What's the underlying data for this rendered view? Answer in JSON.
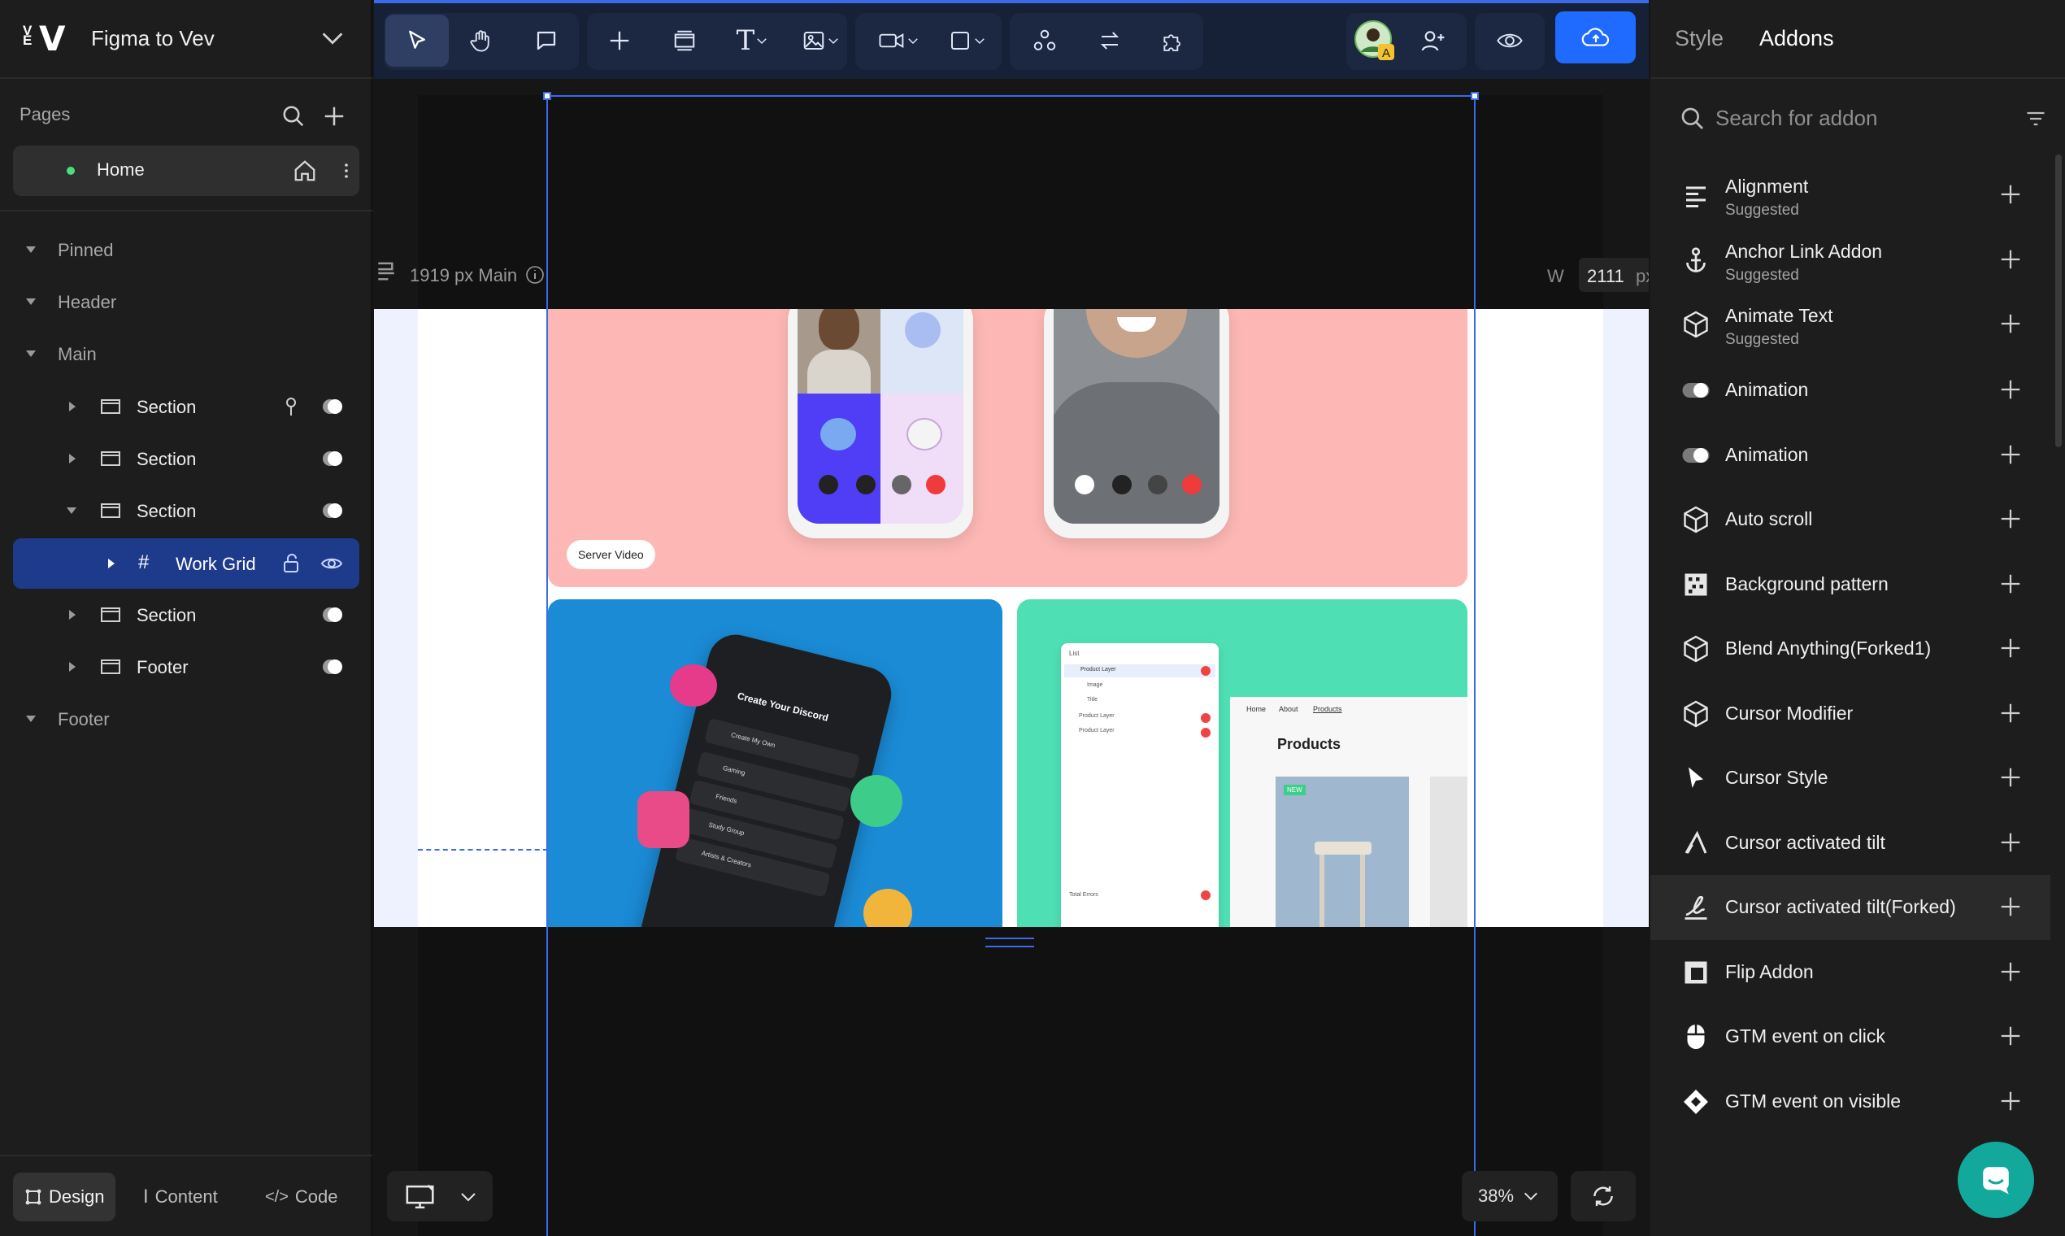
{
  "project": {
    "name": "Figma to Vev"
  },
  "pages": {
    "title": "Pages",
    "items": [
      {
        "label": "Home"
      }
    ]
  },
  "tree": {
    "pinned": "Pinned",
    "header": "Header",
    "main": "Main",
    "section_1": "Section",
    "section_2": "Section",
    "section_3": "Section",
    "work_grid": "Work Grid",
    "section_4": "Section",
    "footer_child": "Footer",
    "footer": "Footer"
  },
  "bottom_tabs": {
    "design": "Design",
    "content": "Content",
    "code": "Code"
  },
  "canvas": {
    "breakpoint_label": "1919 px Main",
    "width_label": "W",
    "width_value": "2111",
    "width_unit": "px",
    "zoom": "38%",
    "chip_label": "Server Video",
    "selection_color": "#3b6ae8",
    "mockup": {
      "discord_title": "Create Your Discord",
      "discord_items": [
        "Create My Own",
        "Gaming",
        "Friends",
        "Study Group",
        "Artists & Creators"
      ],
      "list_title": "List",
      "list_items": [
        "Product Layer",
        "Image",
        "Title",
        "Product Layer",
        "Product Layer"
      ],
      "total_errors": "Total Errors",
      "nav": [
        "Home",
        "About",
        "Products"
      ],
      "products_heading": "Products",
      "new_badge": "NEW"
    }
  },
  "right_panel": {
    "tabs": [
      "Style",
      "Addons"
    ],
    "active_tab": "Addons",
    "search_placeholder": "Search for addon",
    "addons": [
      {
        "name": "Alignment",
        "sub": "Suggested",
        "icon": "align-left-icon"
      },
      {
        "name": "Anchor Link Addon",
        "sub": "Suggested",
        "icon": "anchor-icon"
      },
      {
        "name": "Animate Text",
        "sub": "Suggested",
        "icon": "cube-icon"
      },
      {
        "name": "Animation",
        "sub": "",
        "icon": "toggle-icon"
      },
      {
        "name": "Animation",
        "sub": "",
        "icon": "toggle-icon"
      },
      {
        "name": "Auto scroll",
        "sub": "",
        "icon": "cube-icon"
      },
      {
        "name": "Background pattern",
        "sub": "",
        "icon": "pattern-icon"
      },
      {
        "name": "Blend Anything(Forked1)",
        "sub": "",
        "icon": "cube-icon"
      },
      {
        "name": "Cursor Modifier",
        "sub": "",
        "icon": "cube-icon"
      },
      {
        "name": "Cursor Style",
        "sub": "",
        "icon": "cursor-icon"
      },
      {
        "name": "Cursor activated tilt",
        "sub": "",
        "icon": "tilt-icon"
      },
      {
        "name": "Cursor activated tilt(Forked)",
        "sub": "",
        "icon": "signature-icon"
      },
      {
        "name": "Flip Addon",
        "sub": "",
        "icon": "flip-icon"
      },
      {
        "name": "GTM event on click",
        "sub": "",
        "icon": "mouse-icon"
      },
      {
        "name": "GTM event on visible",
        "sub": "",
        "icon": "diamond-icon"
      }
    ]
  },
  "colors": {
    "accent": "#1f6bff",
    "selected_row": "#1e3a8a",
    "live_dot": "#4ade80",
    "chat": "#12a89c"
  }
}
